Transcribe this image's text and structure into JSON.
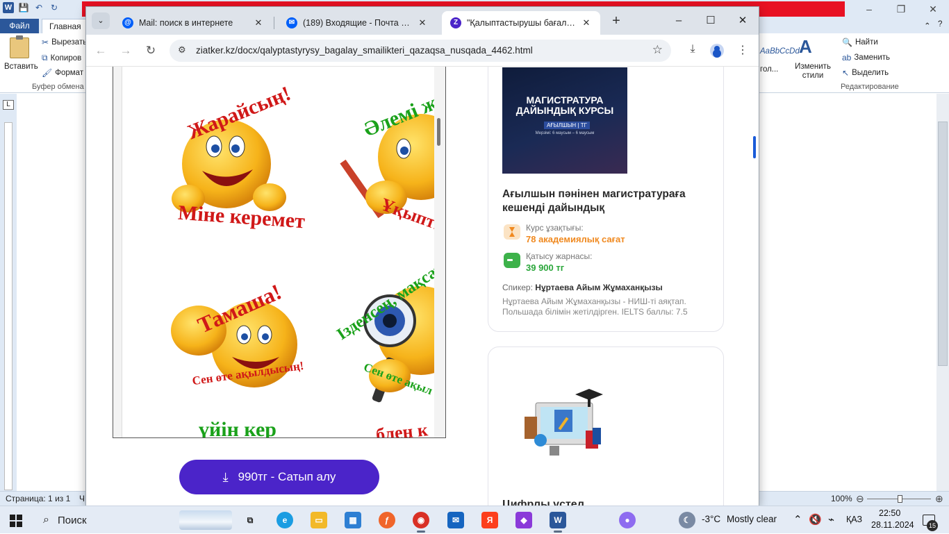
{
  "word": {
    "tabs": {
      "file": "Файл",
      "home": "Главная"
    },
    "ribbon": {
      "paste": "Вставить",
      "cut": "Вырезать",
      "copy": "Копиров",
      "format": "Формат п",
      "clipboard_group": "Буфер обмена",
      "style_sample": "AaBbCcDd",
      "style_name": "гол...",
      "change_styles": "Изменить стили",
      "find": "Найти",
      "replace": "Заменить",
      "select": "Выделить",
      "editing_group": "Редактирование"
    },
    "status": {
      "page": "Страница: 1 из 1",
      "extra": "Ч",
      "zoom": "100%"
    },
    "ruler_corner": "L"
  },
  "browser": {
    "tabs": [
      {
        "title": "Mail: поиск в интернете",
        "favicon": "@",
        "color": "#005ff9"
      },
      {
        "title": "(189) Входящие - Почта Mail",
        "favicon": "✉",
        "color": "#005ff9"
      },
      {
        "title": "\"Қалыптастырушы бағалау см",
        "favicon": "Z",
        "color": "#4b24c9"
      }
    ],
    "url": "ziatker.kz/docx/qalyptastyrysy_bagalay_smailikteri_qazaqsa_nusqada_4462.html"
  },
  "doc": {
    "captions": [
      {
        "text": "Жарайсың!",
        "color": "#d01818"
      },
      {
        "text": "Міне керемет",
        "color": "#d01818"
      },
      {
        "text": "Әлемі ж",
        "color": "#1aa11a"
      },
      {
        "text": "Ұқыпты",
        "color": "#d01818"
      },
      {
        "text": "Тамаша!",
        "color": "#d01818"
      },
      {
        "text": "Сен өте ақылдысың!",
        "color": "#d01818"
      },
      {
        "text": "Ізденсең, мақсаты",
        "color": "#1aa11a"
      },
      {
        "text": "Сен өте ақыл",
        "color": "#1aa11a"
      },
      {
        "text": "үйін кер",
        "color": "#1aa11a"
      },
      {
        "text": "блен к",
        "color": "#d01818"
      }
    ]
  },
  "buy": {
    "label": "990тг - Сатып алу"
  },
  "course": {
    "image_title": "МАГИСТРАТУРА ДАЙЫНДЫҚ КУРСЫ",
    "image_badge": "АҒЫЛШЫН | ТГ",
    "image_sub": "Мерзімі: 6 маусым – 6 маусым",
    "title": "Ағылшын пәнінен магистратураға кешенді дайындық",
    "duration_label": "Курс ұзақтығы:",
    "duration_value": "78 академиялық сағат",
    "price_label": "Қатысу жарнасы:",
    "price_value": "39 900 тг",
    "speaker_prefix": "Спикер:",
    "speaker_name": "Нұртаева Айым Жұмаханқызы",
    "speaker_bio": "Нұртаева Айым Жұмаханқызы - НИШ-ті аяқтап. Польшада білімін жетілдірген. IELTS баллы: 7.5"
  },
  "card2": {
    "title": "Цифрлы үстел"
  },
  "taskbar": {
    "search": "Поиск",
    "temperature": "-3°C",
    "weather": "Mostly clear",
    "lang": "ҚАЗ",
    "time": "22:50",
    "date": "28.11.2024",
    "notifications": "15"
  },
  "colors": {
    "accent": "#4b24c9",
    "orange": "#f0891f",
    "green": "#2aa63a"
  }
}
